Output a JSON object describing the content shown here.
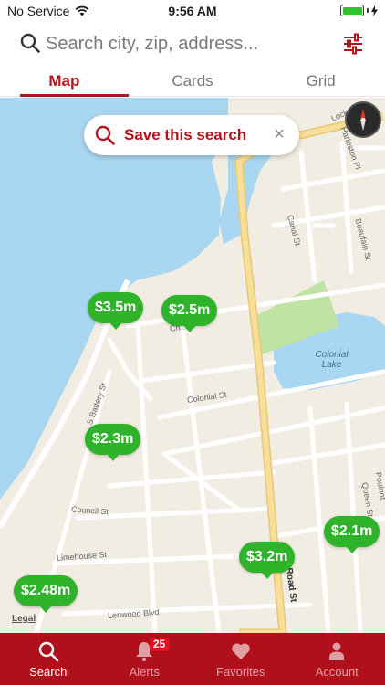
{
  "status_bar": {
    "carrier": "No Service",
    "time": "9:56 AM"
  },
  "search": {
    "placeholder": "Search city, zip, address..."
  },
  "tabs": [
    {
      "label": "Map",
      "active": true
    },
    {
      "label": "Cards",
      "active": false
    },
    {
      "label": "Grid",
      "active": false
    }
  ],
  "map": {
    "save_search_label": "Save this search",
    "legal_label": "Legal",
    "colors": {
      "water": "#a9d6f0",
      "land": "#f2ede3",
      "park": "#bfe3a4",
      "pin": "#2fb32b",
      "major_road": "#f7de99"
    },
    "streets": {
      "lockwood": "Lockwo",
      "ashley": "Harleston Pl",
      "canal": "Canal St",
      "beaufain": "Beaufain St",
      "chisolm": "Ch...St",
      "colonial": "Colonial St",
      "colonial_lake": "Colonial Lake",
      "battery": "S Battery St",
      "council": "Council St",
      "limehouse": "Limehouse St",
      "lenwood": "Lenwood Blvd",
      "queen": "Queen St",
      "poulnot": "Poulnot",
      "rutledge": "Road St"
    },
    "pins": [
      {
        "price": "$3.5m"
      },
      {
        "price": "$2.5m"
      },
      {
        "price": "$2.3m"
      },
      {
        "price": "$2.1m"
      },
      {
        "price": "$3.2m"
      },
      {
        "price": "$2.48m"
      }
    ]
  },
  "bottom_nav": {
    "items": [
      {
        "label": "Search",
        "active": true
      },
      {
        "label": "Alerts",
        "active": false
      },
      {
        "label": "Favorites",
        "active": false
      },
      {
        "label": "Account",
        "active": false
      }
    ],
    "alerts_badge": "25"
  }
}
